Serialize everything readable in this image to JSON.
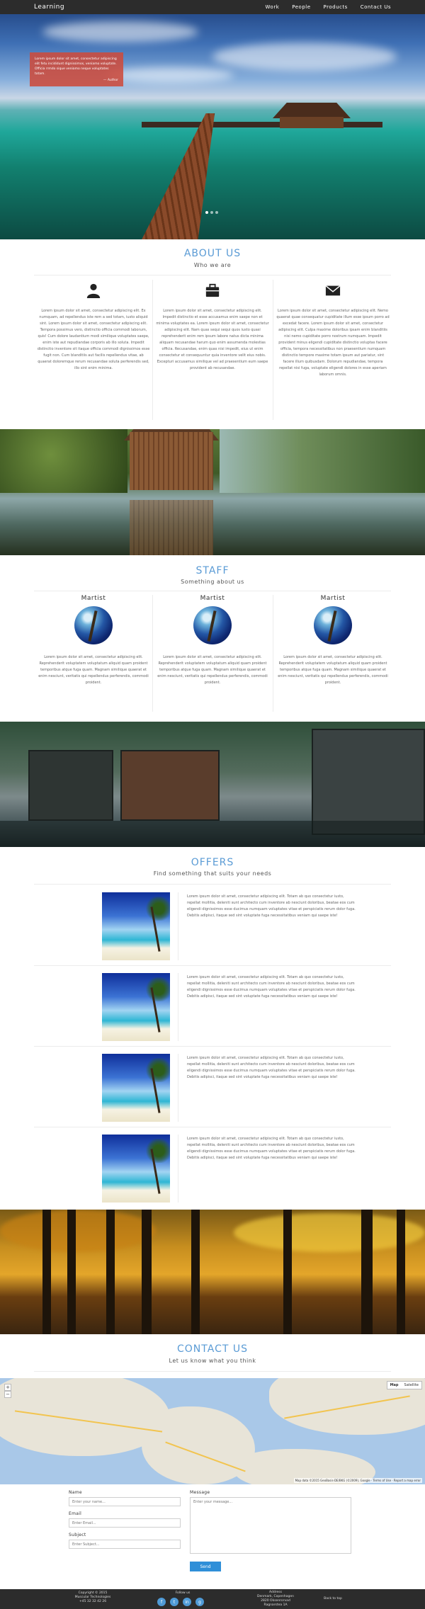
{
  "nav": {
    "brand": "Learning",
    "links": [
      "Work",
      "People",
      "Products",
      "Contact Us"
    ]
  },
  "hero": {
    "quote": "Lorem ipsum dolor sit amet, consectetur adipiscing elit fetu incididunt dignissimos, veniamo voluptate. Officia rrmdo sique veniamo neque voluptates totam.",
    "author": "— Author"
  },
  "about": {
    "title": "ABOUT US",
    "subtitle": "Who we are",
    "columns": [
      {
        "icon": "person-icon",
        "text": "Lorem ipsum dolor sit amet, consectetur adipiscing elit. Ex numquam, ad repellendus iste rem a sed totam, iusto aliquid sint. Lorem ipsum dolor sit amet, consectetur adipiscing elit. Tempora possimus vero, distinctio officia commodi laborum, quis! Cum dolore laudantium modi similique voluptates saepe, enim iste aut repudiandae corporis ab illo soluta. Impedit distinctio inventore sit itaque officia commodi dignissimos esse fugit non. Cum blanditiis aut facilis repellendus vitae, ab quaerat doloremque rerum recusandae soluta perferendis sed, illo sint enim minima."
      },
      {
        "icon": "briefcase-icon",
        "text": "Lorem ipsum dolor sit amet, consectetur adipiscing elit. Impedit distinctio et esse accusamus enim saepe non et minima voluptates ea. Lorem ipsum dolor sit amet, consectetur adipiscing elit. Nam quas sequi sequi quos iusto quasi reprehenderit enim rem ipsum labore natus dicta minima aliquam recusandae harum quo enim assumenda molestias officia. Recusandae, enim quas nisi impedit, eius ut enim consectetur et consequuntur quia inventore velit eius nobis. Excepturi accusamus similique vel ad praesentium eum saepe provident ab recusandae."
      },
      {
        "icon": "envelope-icon",
        "text": "Lorem ipsum dolor sit amet, consectetur adipiscing elit. Nemo quaerat quae consequatur cupiditate illum esse ipsum porro ad excedat facere. Lorem ipsum dolor sit amet, consectetur adipiscing elit. Culpa maxime doloribus ipsam enim blanditiis nisi nemo cupiditate porro nostrum numquam. Impedit provident minus eligendi cupiditate distinctio voluptas facere officia, tempora necessitatibus non praesentium numquam distinctio tempore maxime totam ipsum aut pariatur, sint facere illum quibusdam. Dolorum repudiandae, tempora repellat nisi fuga, voluptate eligendi dolores in esse aperiam laborum omnis."
      }
    ]
  },
  "staff": {
    "title": "STAFF",
    "subtitle": "Something about us",
    "members": [
      {
        "name": "Martist",
        "text": "Lorem ipsum dolor sit amet, consectetur adipiscing elit. Reprehenderit voluptatem voluptatum aliquid quam proident temporibus atque fuga quam. Magnam similique quaerat et enim nesciunt, veritatis qui repellendus perferendis, commodi proident."
      },
      {
        "name": "Martist",
        "text": "Lorem ipsum dolor sit amet, consectetur adipiscing elit. Reprehenderit voluptatem voluptatum aliquid quam proident temporibus atque fuga quam. Magnam similique quaerat et enim nesciunt, veritatis qui repellendus perferendis, commodi proident."
      },
      {
        "name": "Martist",
        "text": "Lorem ipsum dolor sit amet, consectetur adipiscing elit. Reprehenderit voluptatem voluptatum aliquid quam proident temporibus atque fuga quam. Magnam similique quaerat et enim nesciunt, veritatis qui repellendus perferendis, commodi proident."
      }
    ]
  },
  "offers": {
    "title": "OFFERS",
    "subtitle": "Find something that suits your needs",
    "items": [
      {
        "text": "Lorem ipsum dolor sit amet, consectetur adipiscing elit. Totam ab quo consectetur iusto, repellat mollitia, deleniti sunt architecto cum inventore ab nesciunt doloribus, beatae eos cum eligendi dignissimos esse ducimus numquam voluptates vitae et perspiciatis rerum dolor fuga. Debitis adipisci, itaque sed sint voluptate fuga necessitatibus veniam qui saepe iste!"
      },
      {
        "text": "Lorem ipsum dolor sit amet, consectetur adipiscing elit. Totam ab quo consectetur iusto, repellat mollitia, deleniti sunt architecto cum inventore ab nesciunt doloribus, beatae eos cum eligendi dignissimos esse ducimus numquam voluptates vitae et perspiciatis rerum dolor fuga. Debitis adipisci, itaque sed sint voluptate fuga necessitatibus veniam qui saepe iste!"
      },
      {
        "text": "Lorem ipsum dolor sit amet, consectetur adipiscing elit. Totam ab quo consectetur iusto, repellat mollitia, deleniti sunt architecto cum inventore ab nesciunt doloribus, beatae eos cum eligendi dignissimos esse ducimus numquam voluptates vitae et perspiciatis rerum dolor fuga. Debitis adipisci, itaque sed sint voluptate fuga necessitatibus veniam qui saepe iste!"
      },
      {
        "text": "Lorem ipsum dolor sit amet, consectetur adipiscing elit. Totam ab quo consectetur iusto, repellat mollitia, deleniti sunt architecto cum inventore ab nesciunt doloribus, beatae eos cum eligendi dignissimos esse ducimus numquam voluptates vitae et perspiciatis rerum dolor fuga. Debitis adipisci, itaque sed sint voluptate fuga necessitatibus veniam qui saepe iste!"
      }
    ]
  },
  "contact": {
    "title": "CONTACT US",
    "subtitle": "Let us know what you think",
    "map": {
      "toggle": [
        "Map",
        "Satellite"
      ],
      "footer": "Map data ©2015 GeoBasis-DE/BKG (©2009), Google · Terms of Use · Report a map error"
    },
    "form": {
      "name_label": "Name",
      "name_placeholder": "Enter your name...",
      "email_label": "Email",
      "email_placeholder": "Enter Email...",
      "subject_label": "Subject",
      "subject_placeholder": "Enter Subject...",
      "message_label": "Message",
      "message_placeholder": "Enter your message...",
      "send_label": "Send"
    }
  },
  "footer": {
    "copyright": "Copyright © 2015",
    "company": "Muscular Technologies",
    "phone": "+45 32 32 42 26",
    "follow": "Follow us",
    "address_title": "Address",
    "address_1": "Denmark, Copenhagen",
    "address_2": "2820 Oksenrorvad",
    "address_3": "Ragnarstea 1A",
    "back_to_top": "Back to top"
  },
  "colors": {
    "accent": "#5a9bd5",
    "nav_bg": "#2c2c2c",
    "quote_bg": "#cd4b3c",
    "button": "#2f8fd8"
  }
}
